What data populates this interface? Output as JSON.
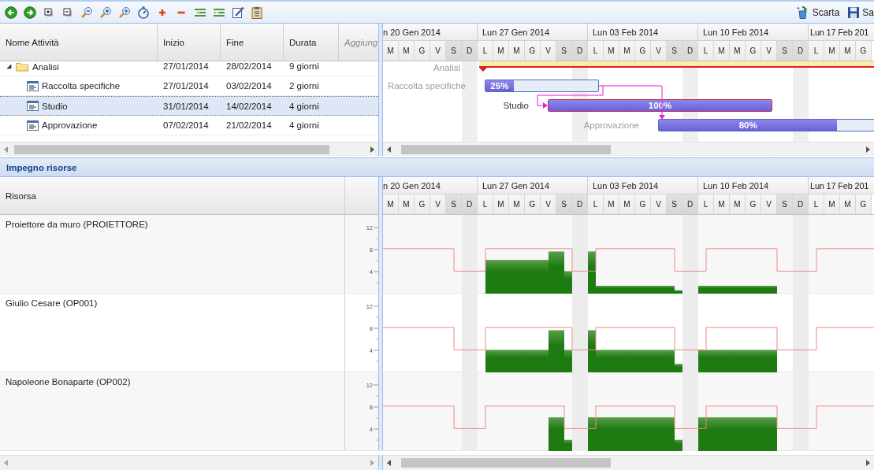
{
  "toolbar": {
    "actions": [
      {
        "kind": "discard",
        "label": "Scarta"
      },
      {
        "kind": "save",
        "label": "Sa"
      }
    ]
  },
  "task_grid": {
    "columns": [
      {
        "kind": "field",
        "label": "Nome Attività"
      },
      {
        "kind": "field",
        "label": "Inizio"
      },
      {
        "kind": "field",
        "label": "Fine"
      },
      {
        "kind": "field",
        "label": "Durata"
      },
      {
        "kind": "add",
        "label": "Aggiung"
      }
    ],
    "tasks": [
      {
        "kind": "summary",
        "name": "Analisi",
        "start": "27/01/2014",
        "end": "28/02/2014",
        "duration": "9 giorni",
        "expanded": true,
        "selected": false,
        "bar": {
          "label": "Analisi"
        },
        "children": [
          {
            "kind": "task",
            "name": "Raccolta specifiche",
            "start": "27/01/2014",
            "end": "03/02/2014",
            "duration": "2 giorni",
            "selected": false,
            "bar": {
              "label": "Raccolta specifiche",
              "percent": "25%",
              "level": 0.25,
              "critical": false
            }
          },
          {
            "kind": "task",
            "name": "Studio",
            "start": "31/01/2014",
            "end": "14/02/2014",
            "duration": "4 giorni",
            "selected": true,
            "bar": {
              "label": "Studio",
              "percent": "100%",
              "level": 1,
              "critical": true
            }
          },
          {
            "kind": "task",
            "name": "Approvazione",
            "start": "07/02/2014",
            "end": "21/02/2014",
            "duration": "4 giorni",
            "selected": false,
            "bar": {
              "label": "Approvazione",
              "percent": "80%",
              "level": 0.8,
              "critical": false
            }
          }
        ]
      }
    ]
  },
  "gantt": {
    "timeline": {
      "weeks": [
        {
          "label": "n 20 Gen 2014"
        },
        {
          "label": "Lun 27 Gen 2014"
        },
        {
          "label": "Lun 03 Feb 2014"
        },
        {
          "label": "Lun 10 Feb 2014"
        },
        {
          "label": "Lun 17 Feb 201"
        }
      ],
      "days": [
        {
          "label": "M",
          "kind": "work"
        },
        {
          "label": "M",
          "kind": "work"
        },
        {
          "label": "G",
          "kind": "work"
        },
        {
          "label": "V",
          "kind": "work"
        },
        {
          "label": "S",
          "kind": "sat"
        },
        {
          "label": "D",
          "kind": "sun"
        },
        {
          "label": "L",
          "kind": "work"
        },
        {
          "label": "M",
          "kind": "work"
        },
        {
          "label": "M",
          "kind": "work"
        },
        {
          "label": "G",
          "kind": "work"
        },
        {
          "label": "V",
          "kind": "work"
        },
        {
          "label": "S",
          "kind": "sat"
        },
        {
          "label": "D",
          "kind": "sun"
        },
        {
          "label": "L",
          "kind": "work"
        },
        {
          "label": "M",
          "kind": "work"
        },
        {
          "label": "M",
          "kind": "work"
        },
        {
          "label": "G",
          "kind": "work"
        },
        {
          "label": "V",
          "kind": "work"
        },
        {
          "label": "S",
          "kind": "sat"
        },
        {
          "label": "D",
          "kind": "sun"
        },
        {
          "label": "L",
          "kind": "work"
        },
        {
          "label": "M",
          "kind": "work"
        },
        {
          "label": "M",
          "kind": "work"
        },
        {
          "label": "G",
          "kind": "work"
        },
        {
          "label": "V",
          "kind": "work"
        },
        {
          "label": "S",
          "kind": "sat"
        },
        {
          "label": "D",
          "kind": "sun"
        },
        {
          "label": "L",
          "kind": "work"
        },
        {
          "label": "M",
          "kind": "work"
        },
        {
          "label": "M",
          "kind": "work"
        },
        {
          "label": "G",
          "kind": "work"
        }
      ]
    }
  },
  "resource_panel": {
    "title": "Impegno risorse",
    "column": "Risorsa",
    "timeline": {
      "weeks": [
        {
          "label": "n 20 Gen 2014"
        },
        {
          "label": "Lun 27 Gen 2014"
        },
        {
          "label": "Lun 03 Feb 2014"
        },
        {
          "label": "Lun 10 Feb 2014"
        },
        {
          "label": "Lun 17 Feb 201"
        }
      ],
      "days": [
        {
          "label": "M",
          "kind": "work"
        },
        {
          "label": "M",
          "kind": "work"
        },
        {
          "label": "G",
          "kind": "work"
        },
        {
          "label": "V",
          "kind": "work"
        },
        {
          "label": "S",
          "kind": "sat"
        },
        {
          "label": "D",
          "kind": "sun"
        },
        {
          "label": "L",
          "kind": "work"
        },
        {
          "label": "M",
          "kind": "work"
        },
        {
          "label": "M",
          "kind": "work"
        },
        {
          "label": "G",
          "kind": "work"
        },
        {
          "label": "V",
          "kind": "work"
        },
        {
          "label": "S",
          "kind": "sat"
        },
        {
          "label": "D",
          "kind": "sun"
        },
        {
          "label": "L",
          "kind": "work"
        },
        {
          "label": "M",
          "kind": "work"
        },
        {
          "label": "M",
          "kind": "work"
        },
        {
          "label": "G",
          "kind": "work"
        },
        {
          "label": "V",
          "kind": "work"
        },
        {
          "label": "S",
          "kind": "sat"
        },
        {
          "label": "D",
          "kind": "sun"
        },
        {
          "label": "L",
          "kind": "work"
        },
        {
          "label": "M",
          "kind": "work"
        },
        {
          "label": "M",
          "kind": "work"
        },
        {
          "label": "G",
          "kind": "work"
        },
        {
          "label": "V",
          "kind": "work"
        },
        {
          "label": "S",
          "kind": "sat"
        },
        {
          "label": "D",
          "kind": "sun"
        },
        {
          "label": "L",
          "kind": "work"
        },
        {
          "label": "M",
          "kind": "work"
        },
        {
          "label": "M",
          "kind": "work"
        },
        {
          "label": "G",
          "kind": "work"
        }
      ]
    },
    "resources": [
      {
        "name": "Proiettore da muro (PROIETTORE)",
        "axis_labels": [
          "12",
          "8",
          "4"
        ]
      },
      {
        "name": "Giulio Cesare (OP001)",
        "axis_labels": [
          "12",
          "8",
          "4"
        ]
      },
      {
        "name": "Napoleone Bonaparte (OP002)",
        "axis_labels": [
          "12",
          "8",
          "4"
        ]
      }
    ]
  }
}
